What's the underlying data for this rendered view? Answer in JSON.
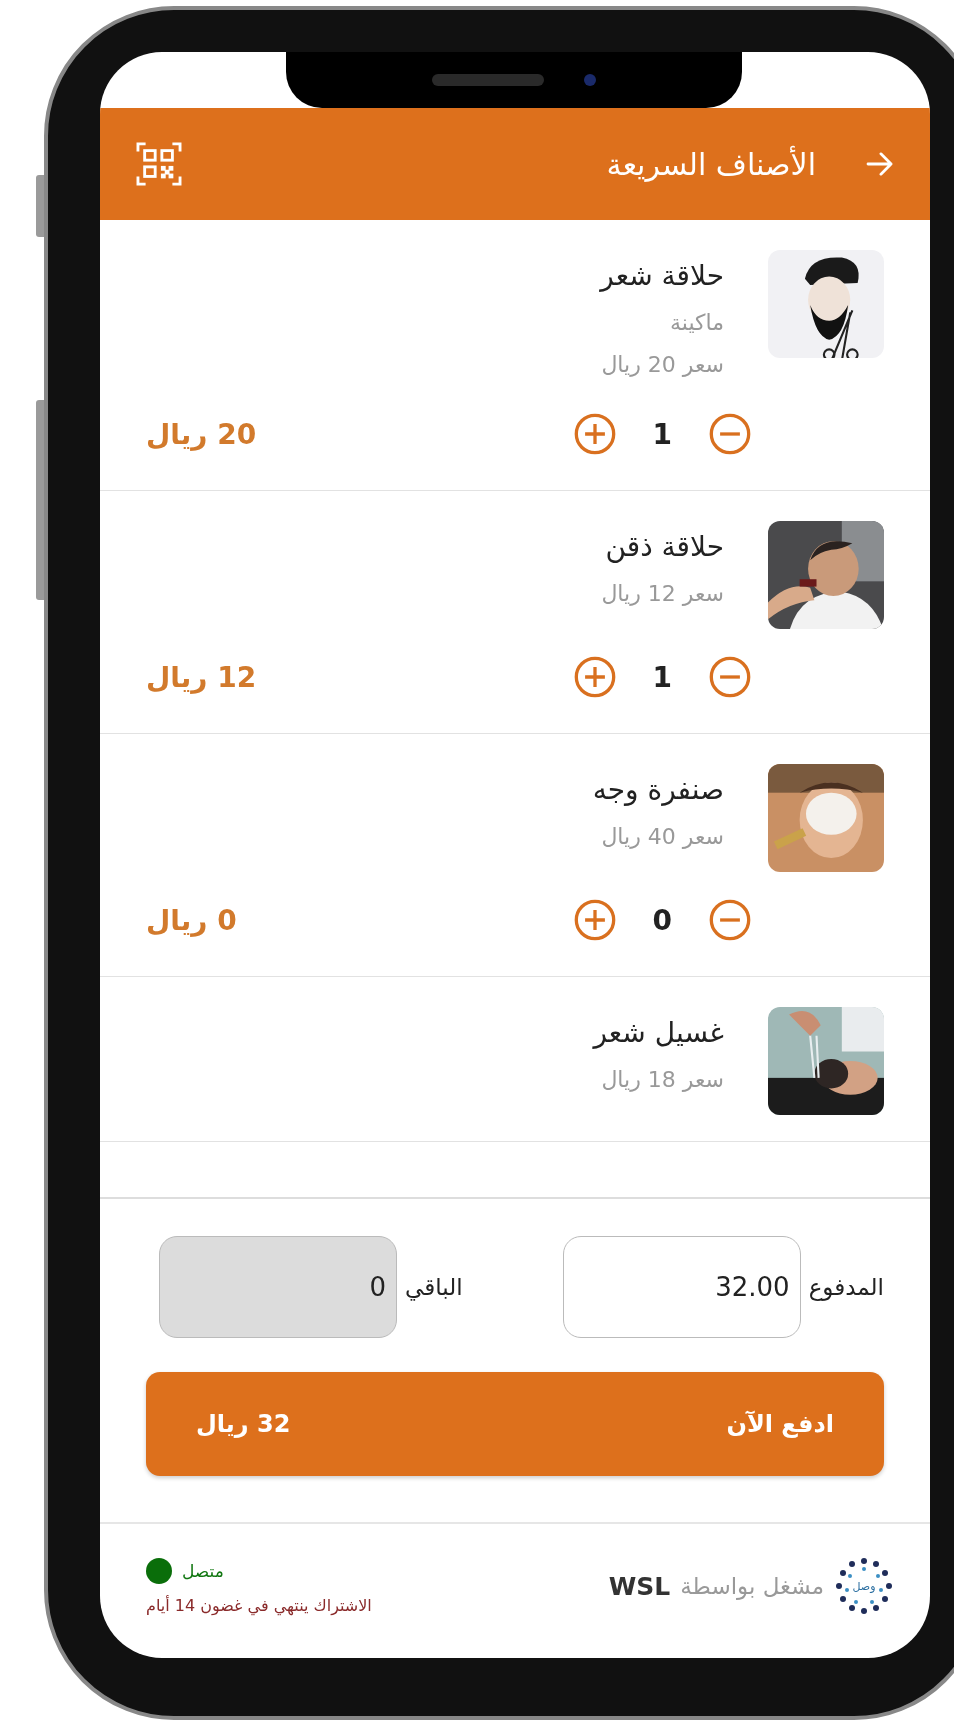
{
  "header": {
    "title": "الأصناف السريعة"
  },
  "items": [
    {
      "name": "حلاقة شعر",
      "subtitle": "ماكينة",
      "price": "سعر 20 ريال",
      "quantity": "1",
      "total": "20 ريال"
    },
    {
      "name": "حلاقة ذقن",
      "price": "سعر 12 ريال",
      "quantity": "1",
      "total": "12 ريال"
    },
    {
      "name": "صنفرة وجه",
      "price": "سعر 40 ريال",
      "quantity": "0",
      "total": "0 ريال"
    },
    {
      "name": "غسيل شعر",
      "price": "سعر 18 ريال"
    }
  ],
  "payment": {
    "paid_label": "المدفوع",
    "paid_value": "32.00",
    "remaining_label": "الباقي",
    "remaining_value": "0",
    "remaining_disabled": true
  },
  "pay_button": {
    "label": "ادفع الآن",
    "amount": "32 ريال"
  },
  "footer": {
    "logo_text": "وصل",
    "powered_by": "مشغل بواسطة",
    "brand": "WSL",
    "status": "متصل",
    "connected": true,
    "subscription": "الاشتراك ينتهي في غضون 14 أيام"
  }
}
